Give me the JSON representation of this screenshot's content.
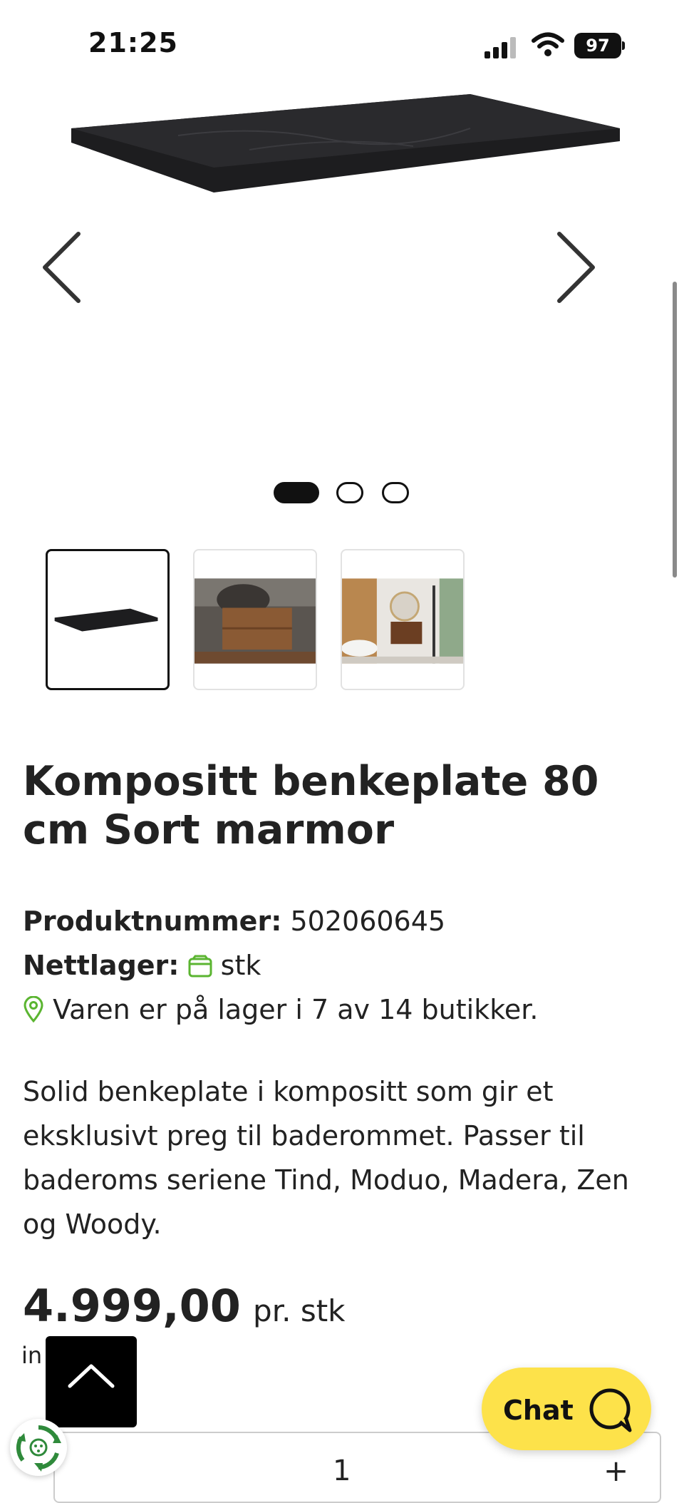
{
  "status_bar": {
    "time": "21:25",
    "battery": "97"
  },
  "gallery": {
    "prev_icon": "chevron-left-icon",
    "next_icon": "chevron-right-icon",
    "slide_count": 3,
    "active_slide": 1
  },
  "product": {
    "title": "Kompositt benkeplate 80 cm Sort marmor",
    "product_number_label": "Produktnummer:",
    "product_number": "502060645",
    "online_stock_label": "Nettlager:",
    "online_stock_unit": "stk",
    "store_stock_text": "Varen er på lager i 7 av 14 butikker.",
    "description": "Solid benkeplate i kompositt som gir et eksklusivt preg til baderommet. Passer til baderoms seriene Tind, Moduo, Madera, Zen og Woody.",
    "price": "4.999,00",
    "price_unit": "pr. stk",
    "vat_text_partial": "in"
  },
  "quantity": {
    "value": "1",
    "plus_label": "+"
  },
  "chat": {
    "label": "Chat"
  },
  "colors": {
    "accent_yellow": "#fde24a",
    "stock_green": "#5bb531"
  }
}
